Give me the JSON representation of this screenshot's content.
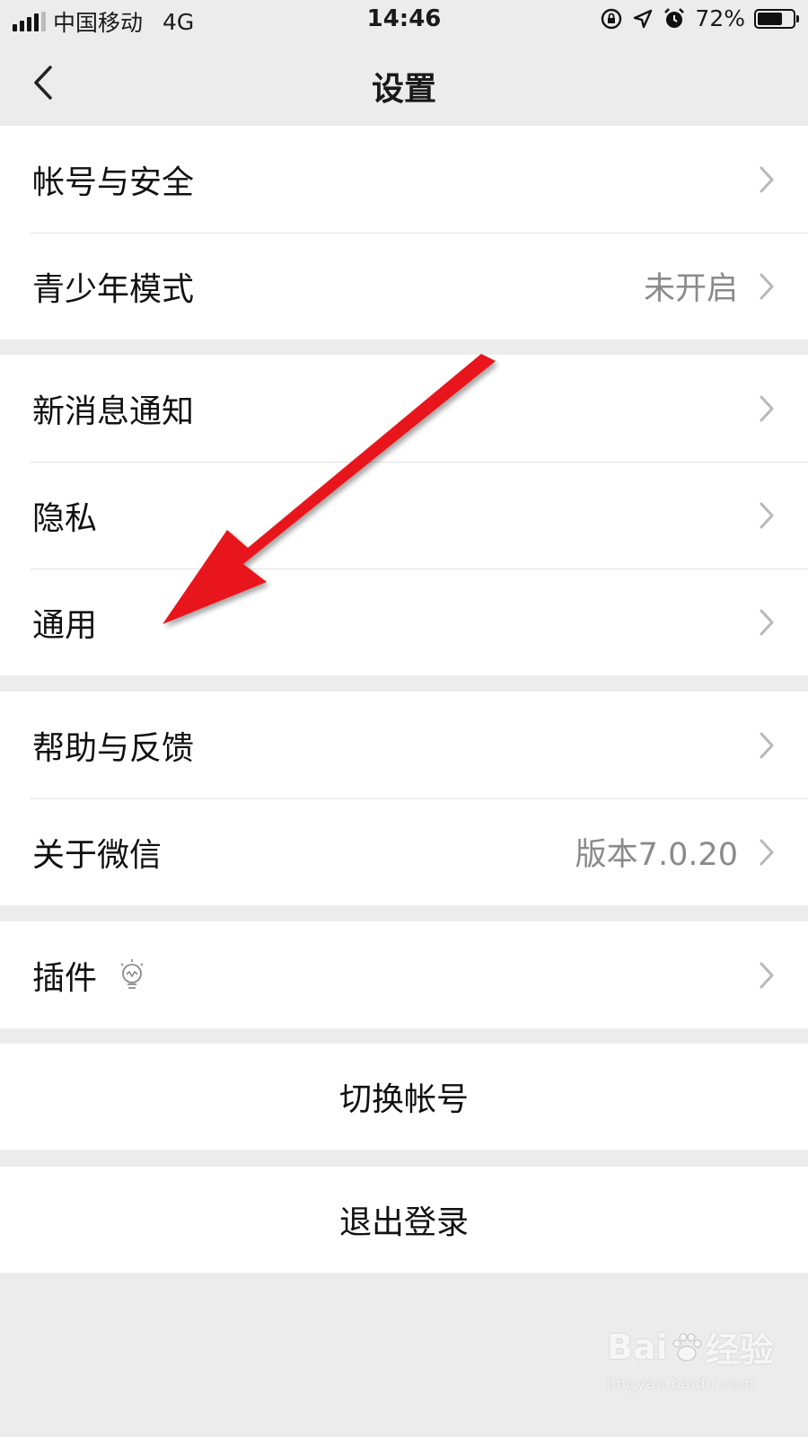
{
  "status_bar": {
    "carrier": "中国移动",
    "network": "4G",
    "time": "14:46",
    "battery_percent_label": "72%",
    "battery_level": 0.72
  },
  "nav": {
    "title": "设置"
  },
  "groups": [
    {
      "items": [
        {
          "label": "帐号与安全",
          "value": ""
        },
        {
          "label": "青少年模式",
          "value": "未开启"
        }
      ]
    },
    {
      "items": [
        {
          "label": "新消息通知",
          "value": ""
        },
        {
          "label": "隐私",
          "value": ""
        },
        {
          "label": "通用",
          "value": ""
        }
      ]
    },
    {
      "items": [
        {
          "label": "帮助与反馈",
          "value": ""
        },
        {
          "label": "关于微信",
          "value": "版本7.0.20"
        }
      ]
    },
    {
      "items": [
        {
          "label": "插件",
          "value": "",
          "icon": "lightbulb-icon"
        }
      ]
    }
  ],
  "actions": {
    "switch_account": "切换帐号",
    "logout": "退出登录"
  },
  "annotation": {
    "arrow_color": "#e8141b",
    "points_to": "通用"
  },
  "watermark": {
    "logo_left": "Bai",
    "logo_right": "经验",
    "url": "jingyan.baidu.com"
  }
}
